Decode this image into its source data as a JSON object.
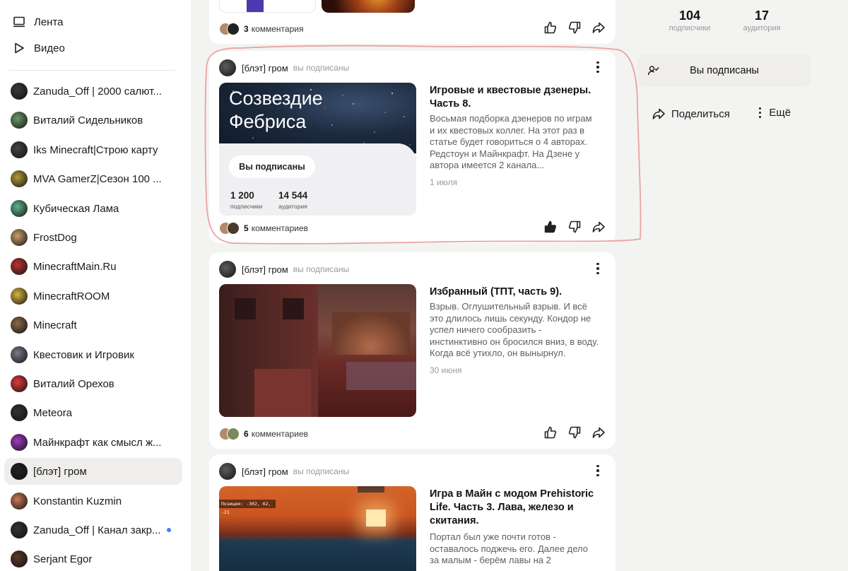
{
  "nav": {
    "feed_label": "Лента",
    "video_label": "Видео"
  },
  "channels": [
    {
      "name": "Zanuda_Off | 2000 салют...",
      "color": "#3a3a3a"
    },
    {
      "name": "Виталий Сидельников",
      "color": "#6a9a6a"
    },
    {
      "name": "Iks Minecraft|Строю карту",
      "color": "#444"
    },
    {
      "name": "MVA GamerZ|Сезон 100 ...",
      "color": "#b59a3a"
    },
    {
      "name": "Кубическая Лама",
      "color": "#5fb38b"
    },
    {
      "name": "FrostDog",
      "color": "#c9a06a"
    },
    {
      "name": "MinecraftMain.Ru",
      "color": "#b33"
    },
    {
      "name": "MinecraftROOM",
      "color": "#d9b440"
    },
    {
      "name": "Minecraft",
      "color": "#8a6a4a"
    },
    {
      "name": "Квестовик и Игровик",
      "color": "#7a7a8a"
    },
    {
      "name": "Виталий Орехов",
      "color": "#e03a3a"
    },
    {
      "name": "Meteora",
      "color": "#333"
    },
    {
      "name": "Майнкрафт как смысл ж...",
      "color": "#a23bbf"
    },
    {
      "name": "[блэт] гром",
      "color": "#222",
      "active": true
    },
    {
      "name": "Konstantin Kuzmin",
      "color": "#c97a5a"
    },
    {
      "name": "Zanuda_Off | Канал закр...",
      "color": "#333",
      "dot": true
    },
    {
      "name": "Serjant Egor",
      "color": "#5a3a2a"
    }
  ],
  "cards": [
    {
      "comments_count": "3",
      "comments_label": "комментария"
    },
    {
      "author": "[блэт] гром",
      "subscribed": "вы подписаны",
      "title": "Игровые и квестовые дзенеры. Часть 8.",
      "excerpt": "Восьмая подборка дзенеров по играм и их квестовых коллег. На этот раз в статье будет говориться о 4 авторах. Редстоун и Майнкрафт. На Дзене у автора имеется 2 канала...",
      "date": "1 июля",
      "thumb_title_line1": "Созвездие",
      "thumb_title_line2": "Фебриса",
      "thumb_button": "Вы подписаны",
      "thumb_subs": "1 200",
      "thumb_subs_label": "подписчики",
      "thumb_aud": "14 544",
      "thumb_aud_label": "аудитория",
      "comments_count": "5",
      "comments_label": "комментариев"
    },
    {
      "author": "[блэт] гром",
      "subscribed": "вы подписаны",
      "title": "Избранный (ТПТ, часть 9).",
      "excerpt": "Взрыв. Оглушительный взрыв. И всё это длилось лишь секунду. Кондор не успел ничего сообразить - инстинктивно он бросился вниз, в воду. Когда всё утихло, он вынырнул.",
      "date": "30 июня",
      "comments_count": "6",
      "comments_label": "комментариев"
    },
    {
      "author": "[блэт] гром",
      "subscribed": "вы подписаны",
      "title": "Игра в Майн с модом Prehistoric Life. Часть 3. Лава, железо и скитания.",
      "excerpt": "Портал был уже почти готов - оставалось поджечь его. Далее дело за малым - берём лавы на 2",
      "thumb_overlay": "Позиция: -302, 62, -21"
    }
  ],
  "right": {
    "subscribers": "104",
    "subscribers_label": "подписчики",
    "audience": "17",
    "audience_label": "аудитория",
    "subscribe_button": "Вы подписаны",
    "share_label": "Поделиться",
    "more_label": "Ещё"
  }
}
